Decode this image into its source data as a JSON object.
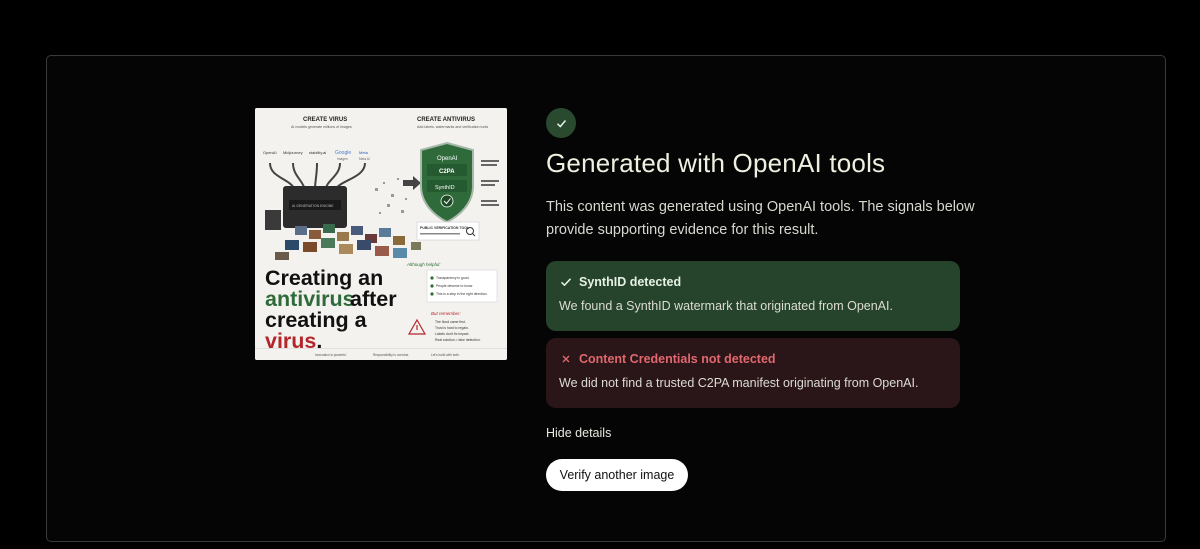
{
  "result": {
    "title": "Generated with OpenAI tools",
    "description": "This content was generated using OpenAI tools. The signals below provide supporting evidence for this result."
  },
  "signals": [
    {
      "status": "ok",
      "icon": "check-icon",
      "title": "SynthID detected",
      "body": "We found a SynthID watermark that originated from OpenAI."
    },
    {
      "status": "fail",
      "icon": "x-icon",
      "title": "Content Credentials not detected",
      "body": "We did not find a trusted C2PA manifest originating from OpenAI."
    }
  ],
  "actions": {
    "hide_details": "Hide details",
    "verify_another": "Verify another image"
  },
  "thumbnail": {
    "create_virus": "CREATE VIRUS",
    "create_antivirus": "CREATE ANTIVIRUS",
    "virus_sub": "AI models generate millions of images",
    "antivirus_sub": "Add labels, watermarks and verification tools",
    "shield_brand": "OpenAI",
    "shield_c2pa": "C2PA",
    "shield_synthid": "SynthID",
    "headline_1": "Creating an",
    "headline_2": "antivirus",
    "headline_3": "after",
    "headline_4": "creating a",
    "headline_5": "virus",
    "headline_dot": ".",
    "machine_label": "AI GENERATION ENGINE",
    "verify_tool": "PUBLIC VERIFICATION TOOL",
    "although": "Although helpful:",
    "but_remember": "But remember:",
    "logos": [
      "OpenAI",
      "Midjourney",
      "stability.ai",
      "Google",
      "Meta"
    ],
    "logo_subs": [
      "Imagen",
      "Meta AI"
    ],
    "helpful_points": [
      "Transparency is good.",
      "People deserve to know.",
      "This is a step in the right direction."
    ],
    "remember_points": [
      "The flood came first.",
      "Trust is hard to regain.",
      "Labels don't fix impact.",
      "Real solution = fake detection."
    ],
    "footer": [
      "Innovation is powerful.",
      "Responsibility is overdue.",
      "Let's build with both."
    ]
  },
  "colors": {
    "ok_bg": "#26432b",
    "fail_bg": "#2a1618",
    "fail_text": "#e0686e",
    "virus_red": "#b3262c",
    "antivirus_green": "#2f6b3a"
  }
}
